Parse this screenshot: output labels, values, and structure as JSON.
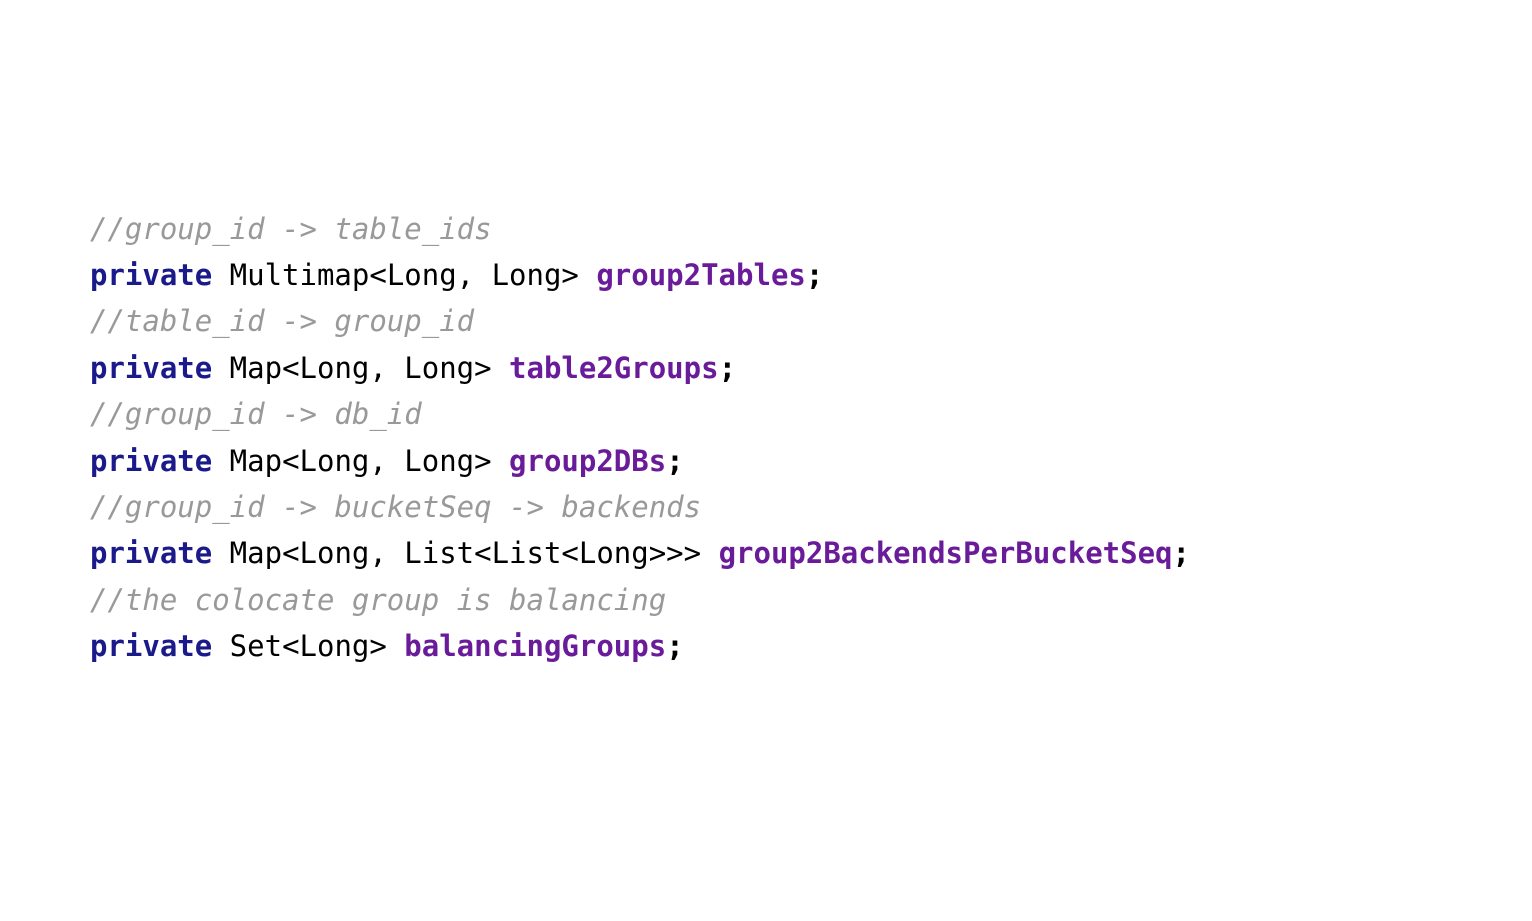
{
  "code": {
    "lines": [
      {
        "kind": "comment",
        "text": "//group_id -> table_ids"
      },
      {
        "kind": "decl",
        "keyword": "private",
        "type_pre": " Multimap",
        "generics": "<Long, Long>",
        "space": " ",
        "field": "group2Tables",
        "semi": ";"
      },
      {
        "kind": "comment",
        "text": "//table_id -> group_id"
      },
      {
        "kind": "decl",
        "keyword": "private",
        "type_pre": " Map",
        "generics": "<Long, Long>",
        "space": " ",
        "field": "table2Groups",
        "semi": ";"
      },
      {
        "kind": "comment",
        "text": "//group_id -> db_id"
      },
      {
        "kind": "decl",
        "keyword": "private",
        "type_pre": " Map",
        "generics": "<Long, Long>",
        "space": " ",
        "field": "group2DBs",
        "semi": ";"
      },
      {
        "kind": "comment",
        "text": "//group_id -> bucketSeq -> backends"
      },
      {
        "kind": "decl",
        "keyword": "private",
        "type_pre": " Map",
        "generics": "<Long, List<List<Long>>>",
        "space": " ",
        "field": "group2BackendsPerBucketSeq",
        "semi": ";"
      },
      {
        "kind": "comment",
        "text": "//the colocate group is balancing"
      },
      {
        "kind": "decl",
        "keyword": "private",
        "type_pre": " Set",
        "generics": "<Long>",
        "space": " ",
        "field": "balancingGroups",
        "semi": ";"
      }
    ]
  }
}
